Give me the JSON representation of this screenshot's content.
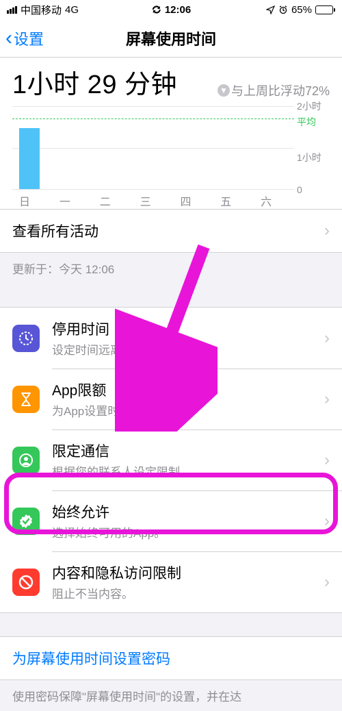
{
  "status": {
    "carrier": "中国移动",
    "network": "4G",
    "time": "12:06",
    "battery_pct": "65%"
  },
  "nav": {
    "back": "设置",
    "title": "屏幕使用时间"
  },
  "summary": {
    "total": "1小时 29 分钟",
    "compare": "与上周比浮动72%"
  },
  "chart_data": {
    "type": "bar",
    "categories": [
      "日",
      "一",
      "二",
      "三",
      "四",
      "五",
      "六"
    ],
    "values": [
      1.48,
      0,
      0,
      0,
      0,
      0,
      0
    ],
    "ylabels": {
      "top": "2小时",
      "avg": "平均",
      "mid": "1小时",
      "bottom": "0"
    },
    "ylim": [
      0,
      2
    ],
    "avg_line": 1.7
  },
  "rows": {
    "all_activity": "查看所有活动",
    "updated": "更新于：今天 12:06",
    "downtime": {
      "title": "停用时间",
      "sub": "设定时间远离屏幕。"
    },
    "app_limits": {
      "title": "App限额",
      "sub": "为App设置时间限额。"
    },
    "communication": {
      "title": "限定通信",
      "sub": "根据您的联系人设定限制。"
    },
    "always_allowed": {
      "title": "始终允许",
      "sub": "选择始终可用的App。"
    },
    "content": {
      "title": "内容和隐私访问限制",
      "sub": "阻止不当内容。"
    },
    "passcode": "为屏幕使用时间设置密码",
    "footer": "使用密码保障\"屏幕使用时间\"的设置，并在达"
  }
}
